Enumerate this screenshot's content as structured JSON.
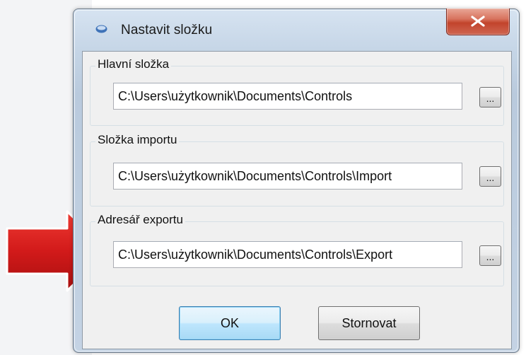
{
  "window": {
    "title": "Nastavit složku",
    "close_glyph": "X",
    "app_icon": "folder-icon"
  },
  "groups": [
    {
      "label": "Hlavní složka",
      "value": "C:\\Users\\użytkownik\\Documents\\Controls",
      "browse_label": "..."
    },
    {
      "label": "Složka importu",
      "value": "C:\\Users\\użytkownik\\Documents\\Controls\\Import",
      "browse_label": "..."
    },
    {
      "label": "Adresář exportu",
      "value": "C:\\Users\\użytkownik\\Documents\\Controls\\Export",
      "browse_label": "..."
    }
  ],
  "buttons": {
    "ok_label": "OK",
    "cancel_label": "Stornovat"
  },
  "annotation": {
    "arrow_color": "#d21a1a",
    "arrow_icon": "red-pointer-arrow-icon"
  }
}
